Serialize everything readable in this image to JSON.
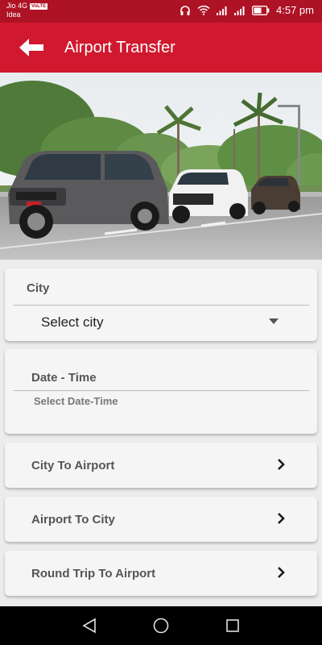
{
  "status_bar": {
    "carrier_line1": "Jio 4G",
    "volte_badge": "VoLTE",
    "carrier_line2": "Idea",
    "time": "4:57 pm"
  },
  "app_bar": {
    "title": "Airport Transfer",
    "back_icon": "arrow-left-icon"
  },
  "colors": {
    "status_bar": "#ae1225",
    "app_bar": "#d0192f",
    "background": "#ececec",
    "card": "#f5f5f5"
  },
  "form": {
    "city": {
      "label": "City",
      "selected_value": "Select city"
    },
    "datetime": {
      "label": "Date - Time",
      "placeholder": "Select Date-Time"
    }
  },
  "options": [
    {
      "label": "City To Airport",
      "icon": "chevron-right-icon"
    },
    {
      "label": "Airport To City",
      "icon": "chevron-right-icon"
    },
    {
      "label": "Round Trip To Airport",
      "icon": "chevron-right-icon"
    }
  ],
  "nav_bar": {
    "back": "nav-back-icon",
    "home": "nav-home-icon",
    "recents": "nav-recents-icon"
  }
}
